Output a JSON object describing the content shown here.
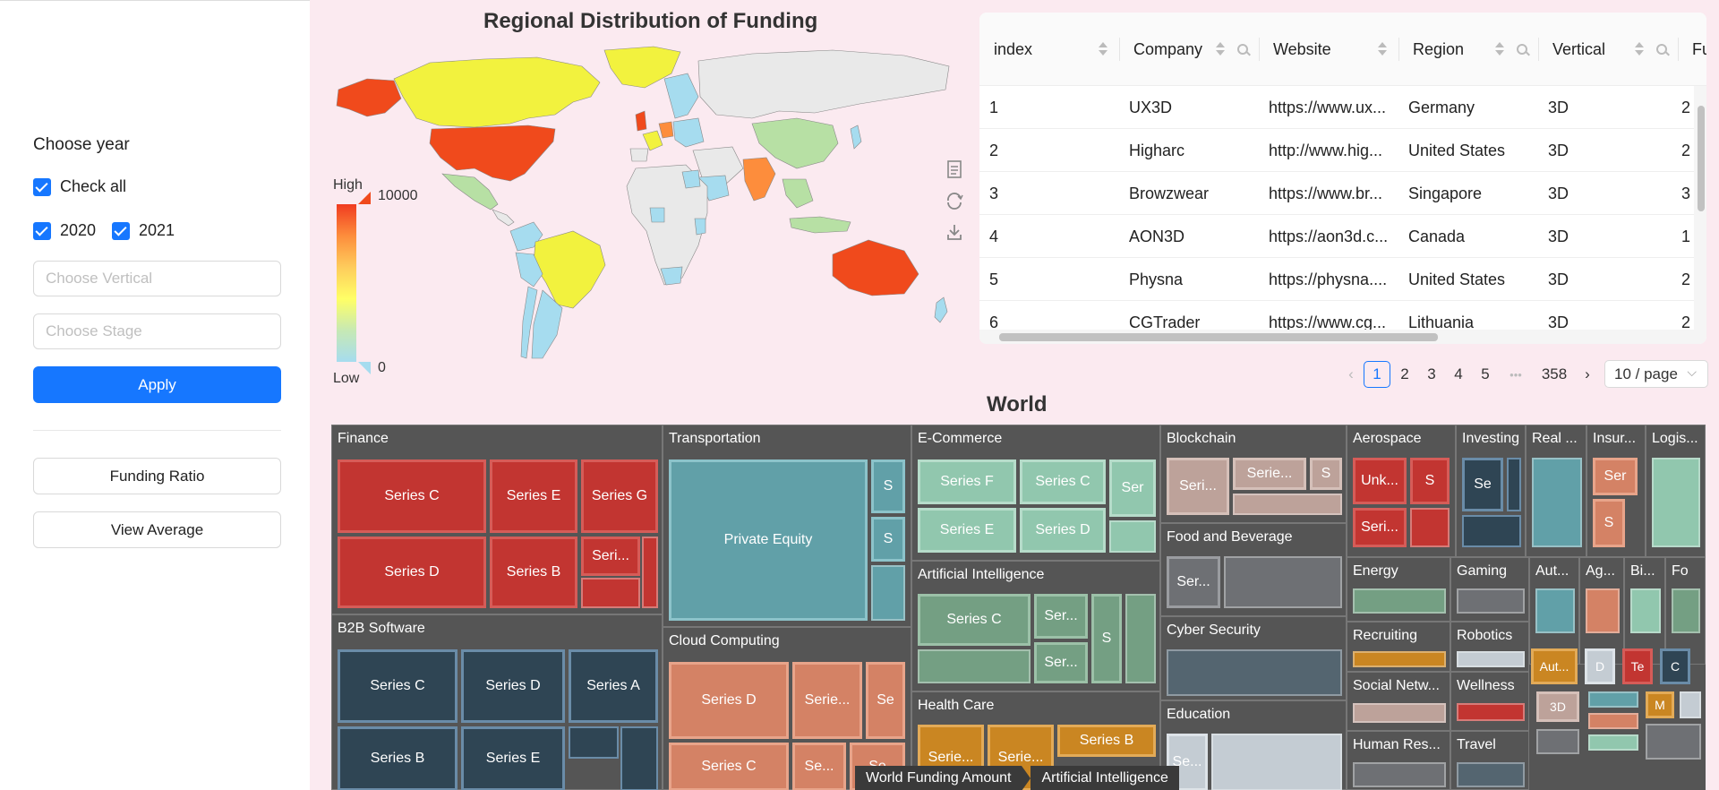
{
  "sidebar": {
    "title": "Choose year",
    "check_all": "Check all",
    "year_options": [
      "2020",
      "2021"
    ],
    "vertical_placeholder": "Choose Vertical",
    "stage_placeholder": "Choose Stage",
    "apply_label": "Apply",
    "funding_ratio_label": "Funding Ratio",
    "view_average_label": "View Average"
  },
  "map": {
    "title": "Regional Distribution of Funding",
    "legend_high": "High",
    "legend_low": "Low",
    "legend_max": "10000",
    "legend_min": "0",
    "colors": {
      "ocean": "#fbeaf0",
      "no_data": "#e9e9e9",
      "high": "#f04a1c",
      "mid_high": "#fd8d3c",
      "mid": "#f2f23e",
      "mid_low": "#b7e0a4",
      "low": "#a6dcef"
    },
    "tools": [
      "data-view-icon",
      "restore-icon",
      "save-image-icon"
    ]
  },
  "table": {
    "columns": [
      "index",
      "Company",
      "Website",
      "Region",
      "Vertical",
      "Fu"
    ],
    "rows": [
      [
        "1",
        "UX3D",
        "https://www.ux...",
        "Germany",
        "3D",
        "2"
      ],
      [
        "2",
        "Higharc",
        "http://www.hig...",
        "United States",
        "3D",
        "2"
      ],
      [
        "3",
        "Browzwear",
        "https://www.br...",
        "Singapore",
        "3D",
        "3"
      ],
      [
        "4",
        "AON3D",
        "https://aon3d.c...",
        "Canada",
        "3D",
        "1"
      ],
      [
        "5",
        "Physna",
        "https://physna....",
        "United States",
        "3D",
        "2"
      ],
      [
        "6",
        "CGTrader",
        "https://www.cg...",
        "Lithuania",
        "3D",
        "2"
      ]
    ]
  },
  "pagination": {
    "pages": [
      "1",
      "2",
      "3",
      "4",
      "5",
      "358"
    ],
    "ellipsis": "•••",
    "page_size": "10 / page",
    "current": "1"
  },
  "treemap": {
    "title": "World",
    "breadcrumb": [
      "World Funding Amount",
      "Artificial Intelligence"
    ],
    "groups": [
      {
        "name": "Finance",
        "color": "#c23531",
        "cells": [
          "Series C",
          "Series E",
          "Series G",
          "Series D",
          "Series B",
          "Seri..."
        ]
      },
      {
        "name": "B2B Software",
        "color": "#2f4554",
        "cells": [
          "Series C",
          "Series D",
          "Series A",
          "Series B",
          "Series E"
        ]
      },
      {
        "name": "Transportation",
        "color": "#61a0a8",
        "cells": [
          "Private Equity",
          "S",
          "S"
        ]
      },
      {
        "name": "Cloud Computing",
        "color": "#d48265",
        "cells": [
          "Series D",
          "Serie...",
          "Se",
          "Series C",
          "Se...",
          "Se"
        ]
      },
      {
        "name": "E-Commerce",
        "color": "#91c7ae",
        "cells": [
          "Series F",
          "Series C",
          "Ser",
          "Series E",
          "Series D"
        ]
      },
      {
        "name": "Artificial Intelligence",
        "color": "#749f83",
        "cells": [
          "Series C",
          "Ser...",
          "S",
          "Ser..."
        ]
      },
      {
        "name": "Health Care",
        "color": "#ca8622",
        "cells": [
          "Serie...",
          "Serie...",
          "Series B"
        ]
      },
      {
        "name": "Blockchain",
        "color": "#bda29a",
        "cells": [
          "Seri...",
          "Serie...",
          "S"
        ]
      },
      {
        "name": "Food and Beverage",
        "color": "#6e7074",
        "cells": [
          "Ser..."
        ]
      },
      {
        "name": "Cyber Security",
        "color": "#546570",
        "cells": []
      },
      {
        "name": "Education",
        "color": "#c4ccd3",
        "cells": [
          "Se..."
        ]
      },
      {
        "name": "Aerospace",
        "color": "#c23531",
        "cells": [
          "Unk...",
          "S",
          "Seri..."
        ]
      },
      {
        "name": "Investing",
        "color": "#2f4554",
        "cells": [
          "Se"
        ]
      },
      {
        "name": "Real ...",
        "color": "#61a0a8",
        "cells": []
      },
      {
        "name": "Insur...",
        "color": "#d48265",
        "cells": [
          "Ser",
          "S"
        ]
      },
      {
        "name": "Logis...",
        "color": "#91c7ae",
        "cells": []
      },
      {
        "name": "Energy",
        "color": "#749f83",
        "cells": []
      },
      {
        "name": "Gaming",
        "color": "#6e7074",
        "cells": []
      },
      {
        "name": "Aut...",
        "color": "#61a0a8",
        "cells": []
      },
      {
        "name": "Ag...",
        "color": "#d48265",
        "cells": []
      },
      {
        "name": "Bi...",
        "color": "#91c7ae",
        "cells": []
      },
      {
        "name": "Fo",
        "color": "#749f83",
        "cells": []
      },
      {
        "name": "Recruiting",
        "color": "#ca8622",
        "cells": []
      },
      {
        "name": "Robotics",
        "color": "#c4ccd3",
        "cells": []
      },
      {
        "name": "Social Netw...",
        "color": "#bda29a",
        "cells": []
      },
      {
        "name": "Wellness",
        "color": "#c23531",
        "cells": []
      },
      {
        "name": "Human Res...",
        "color": "#6e7074",
        "cells": []
      },
      {
        "name": "Travel",
        "color": "#546570",
        "cells": []
      }
    ],
    "small_labels": [
      "Aut...",
      "D",
      "Te",
      "C",
      "3D",
      "M"
    ]
  }
}
